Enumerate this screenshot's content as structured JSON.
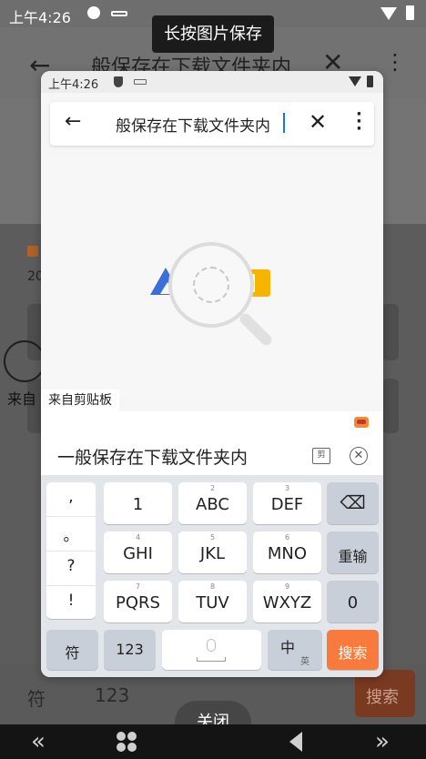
{
  "background": {
    "status_time": "上午4:26",
    "query": "般保存在下载文件夹内",
    "side_label": "来自",
    "side_number": "20",
    "key_fu": "符",
    "key_123": "123",
    "key_search": "搜索"
  },
  "tooltip": {
    "text": "长按图片保存"
  },
  "preview": {
    "status_time": "上午4:26",
    "search": {
      "query": "般保存在下载文件夹内"
    },
    "clipboard_tag": "来自剪贴板",
    "candidate_text": "一般保存在下载文件夹内",
    "candidate_icon_label": "剪",
    "keyboard": {
      "punctuation": [
        ",",
        "。",
        "?",
        "!"
      ],
      "row1": [
        {
          "num": "",
          "label": "1"
        },
        {
          "num": "2",
          "label": "ABC"
        },
        {
          "num": "3",
          "label": "DEF"
        }
      ],
      "row2": [
        {
          "num": "4",
          "label": "GHI"
        },
        {
          "num": "5",
          "label": "JKL"
        },
        {
          "num": "6",
          "label": "MNO"
        }
      ],
      "row3": [
        {
          "num": "7",
          "label": "PQRS"
        },
        {
          "num": "8",
          "label": "TUV"
        },
        {
          "num": "9",
          "label": "WXYZ"
        }
      ],
      "backspace_icon": "backspace-icon",
      "reenter_label": "重输",
      "zero_label": "0",
      "fu_label": "符",
      "num_label": "123",
      "space_icon": "microphone-icon",
      "lang_main": "中",
      "lang_sub": "英",
      "search_label": "搜索",
      "search_color": "#f97a3d"
    }
  },
  "close_button": {
    "label": "关闭"
  },
  "navbar": {
    "items": [
      "double-left-icon",
      "home-icon",
      "back-icon",
      "double-right-icon"
    ]
  }
}
